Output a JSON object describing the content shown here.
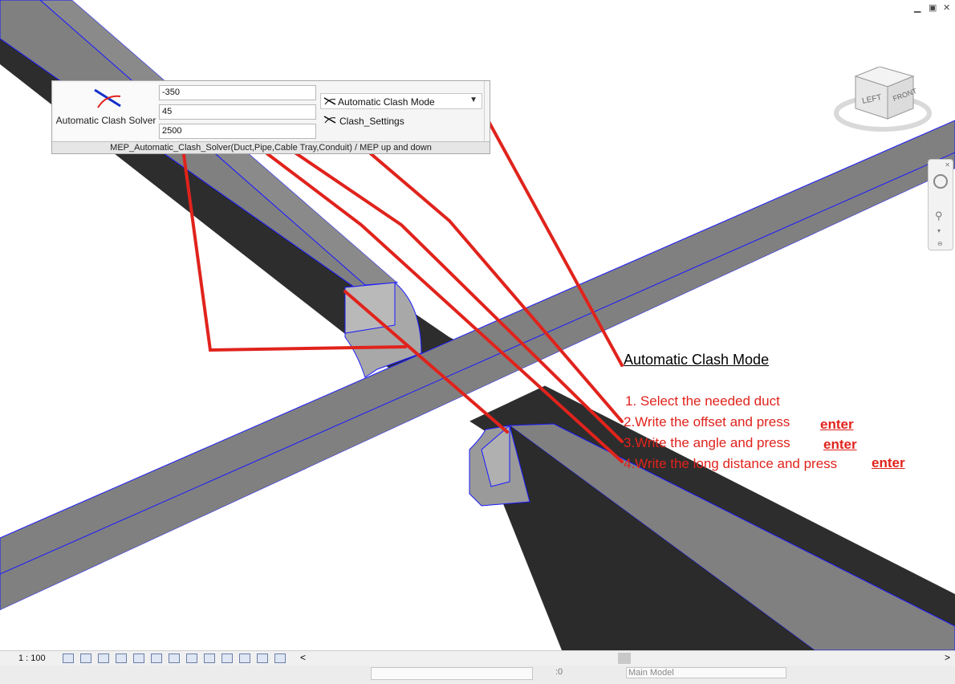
{
  "ribbon_panel": {
    "tool_label": "Automatic Clash Solver",
    "offset_value": "-350",
    "angle_value": "45",
    "distance_value": "2500",
    "mode_selected": "Automatic Clash Mode",
    "settings_label": "Clash_Settings",
    "panel_title": "MEP_Automatic_Clash_Solver(Duct,Pipe,Cable Tray,Conduit) / MEP up and down"
  },
  "view_cube": {
    "left_label": "LEFT",
    "front_label": "FRONT"
  },
  "annotations": {
    "title": "Automatic Clash Mode",
    "step1": "1. Select the needed duct",
    "step2": "2.Write the offset and press",
    "step3": "3.Write the angle and press",
    "step4": "4.Write the long distance and press",
    "enter": "enter"
  },
  "status_bar": {
    "scale": "1 : 100",
    "scroll_left": "<",
    "scroll_right": ">",
    "model": "Main Model",
    "zero": ":0"
  },
  "colors": {
    "duct_top": "#808080",
    "duct_side": "#2f2f2f",
    "edge": "#0000cc",
    "annotation": "#e0231c"
  }
}
